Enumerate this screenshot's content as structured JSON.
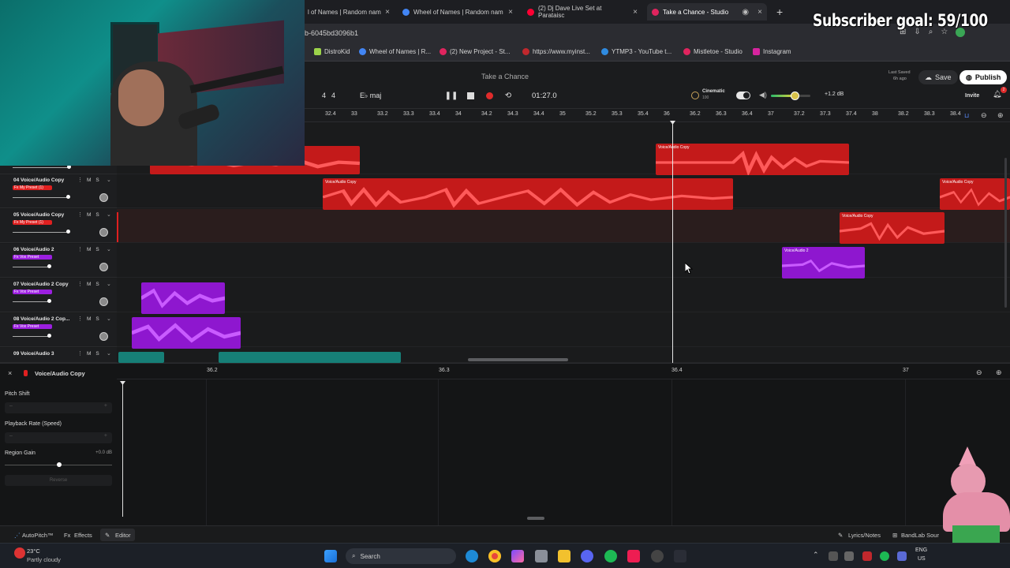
{
  "browser": {
    "tabs": [
      {
        "label": "l of Names | Random nam",
        "color": "#5b8cff"
      },
      {
        "label": "Wheel of Names | Random nam",
        "color": "#4285f4"
      },
      {
        "label": "(2) Dj Dave Live Set at Parataisc",
        "color": "#ff0033"
      },
      {
        "label": "Take a Chance - Studio",
        "color": "#e0245e"
      }
    ],
    "url": "b-6045bd3096b1",
    "bookmarks": [
      {
        "label": "DistroKid",
        "color": "#9cd34a"
      },
      {
        "label": "Wheel of Names | R...",
        "color": "#4285f4"
      },
      {
        "label": "(2) New Project - St...",
        "color": "#e0245e"
      },
      {
        "label": "https://www.myinst...",
        "color": "#c0282d"
      },
      {
        "label": "YTMP3 - YouTube t...",
        "color": "#2f8be0"
      },
      {
        "label": "Mistletoe - Studio",
        "color": "#e0245e"
      },
      {
        "label": "Instagram",
        "color": "#d6249f"
      }
    ]
  },
  "header": {
    "project_title": "Take a Chance",
    "time_signature_num": "4",
    "time_signature_den": "4",
    "key": "E♭ maj",
    "time": "01:27.0",
    "preset_name": "Cinematic",
    "preset_value": "100",
    "gain": "+1.2 dB",
    "gain_level": 0.6,
    "last_saved_label": "Last Saved",
    "last_saved_time": "6h ago",
    "save_label": "Save",
    "publish_label": "Publish",
    "invite_label": "Invite",
    "notifications": "2"
  },
  "ruler_marks": [
    "32.4",
    "33",
    "33.2",
    "33.3",
    "33.4",
    "34",
    "34.2",
    "34.3",
    "34.4",
    "35",
    "35.2",
    "35.3",
    "35.4",
    "36",
    "36.2",
    "36.3",
    "36.4",
    "37",
    "37.2",
    "37.3",
    "37.4",
    "38",
    "38.2",
    "38.3",
    "38.4"
  ],
  "tracks": [
    {
      "number": "04",
      "name": "Voice/Audio Copy",
      "fx": "Fx My Preset (1)",
      "color": "#e02020",
      "volume": 0.58
    },
    {
      "number": "05",
      "name": "Voice/Audio Copy",
      "fx": "Fx My Preset (1)",
      "color": "#e02020",
      "volume": 0.58
    },
    {
      "number": "06",
      "name": "Voice/Audio 2",
      "fx": "Fx Vox Preset",
      "color": "#9b1fe0",
      "volume": 0.38
    },
    {
      "number": "07",
      "name": "Voice/Audio 2 Copy",
      "fx": "Fx Vox Preset",
      "color": "#9b1fe0",
      "volume": 0.38
    },
    {
      "number": "08",
      "name": "Voice/Audio 2 Cop...",
      "fx": "Fx Vox Preset",
      "color": "#9b1fe0",
      "volume": 0.38
    },
    {
      "number": "09",
      "name": "Voice/Audio 3",
      "fx": "",
      "color": "#1a9a8f",
      "volume": 0.4
    }
  ],
  "track_mute": "M",
  "track_solo": "S",
  "clip_labels": {
    "red_copy": "Voice/Audio Copy",
    "purple": "Voice/Audio 2"
  },
  "editor": {
    "track_name": "Voice/Audio Copy",
    "pitch_shift_label": "Pitch Shift",
    "playback_rate_label": "Playback Rate (Speed)",
    "region_gain_label": "Region Gain",
    "region_gain_value": "+0.0 dB",
    "reverse_label": "Reverse",
    "ruler": [
      "36.2",
      "36.3",
      "36.4",
      "37"
    ]
  },
  "footer": {
    "autopitch": "AutoPitch™",
    "effects": "Effects",
    "editor": "Editor",
    "lyrics": "Lyrics/Notes",
    "bandlab": "BandLab Sour"
  },
  "taskbar": {
    "weather_temp": "23°C",
    "weather_desc": "Partly cloudy",
    "search_placeholder": "Search",
    "lang_top": "ENG",
    "lang_bottom": "US"
  },
  "overlay": {
    "subscriber_goal": "Subscriber goal: 59/100"
  }
}
